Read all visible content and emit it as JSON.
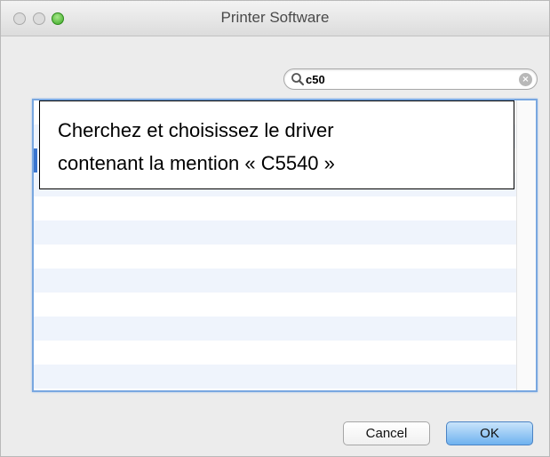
{
  "window": {
    "title": "Printer Software"
  },
  "search": {
    "value": "c50",
    "clear_glyph": "×",
    "icon": "magnifier-icon"
  },
  "callout": {
    "line1": "Cherchez et choisissez le driver",
    "line2": "contenant la mention « C5540 »"
  },
  "buttons": {
    "cancel_label": "Cancel",
    "ok_label": "OK"
  },
  "colors": {
    "accent": "#6fb2ef",
    "list_focus": "#79a7e0",
    "row_alt": "#eff4fc",
    "selection": "#3a75cf"
  }
}
